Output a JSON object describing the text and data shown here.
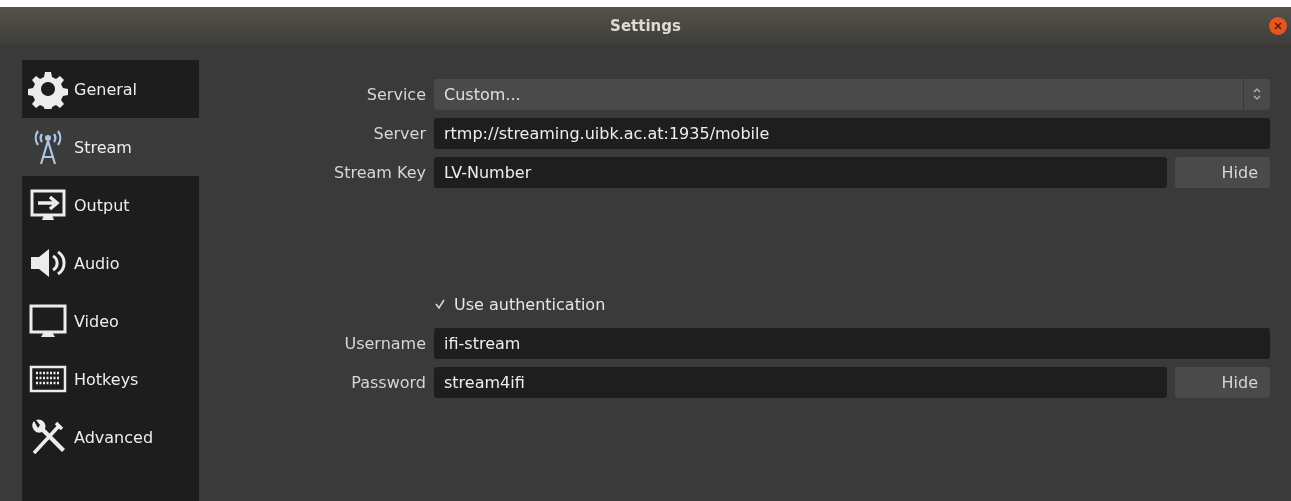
{
  "window": {
    "title": "Settings"
  },
  "sidebar": {
    "items": [
      {
        "label": "General",
        "selected": false
      },
      {
        "label": "Stream",
        "selected": true
      },
      {
        "label": "Output",
        "selected": false
      },
      {
        "label": "Audio",
        "selected": false
      },
      {
        "label": "Video",
        "selected": false
      },
      {
        "label": "Hotkeys",
        "selected": false
      },
      {
        "label": "Advanced",
        "selected": false
      }
    ]
  },
  "form": {
    "rows": [
      {
        "kind": "select",
        "label": "Service",
        "value": "Custom..."
      },
      {
        "kind": "text",
        "label": "Server",
        "value": "rtmp://streaming.uibk.ac.at:1935/mobile"
      },
      {
        "kind": "secret",
        "label": "Stream Key",
        "value": "LV-Number",
        "button": "Hide"
      },
      {
        "kind": "spacer"
      },
      {
        "kind": "checkbox",
        "label": "Use authentication",
        "checked": true
      },
      {
        "kind": "text",
        "label": "Username",
        "value": "ifi-stream"
      },
      {
        "kind": "secret",
        "label": "Password",
        "value": "stream4ifi",
        "button": "Hide"
      }
    ]
  }
}
